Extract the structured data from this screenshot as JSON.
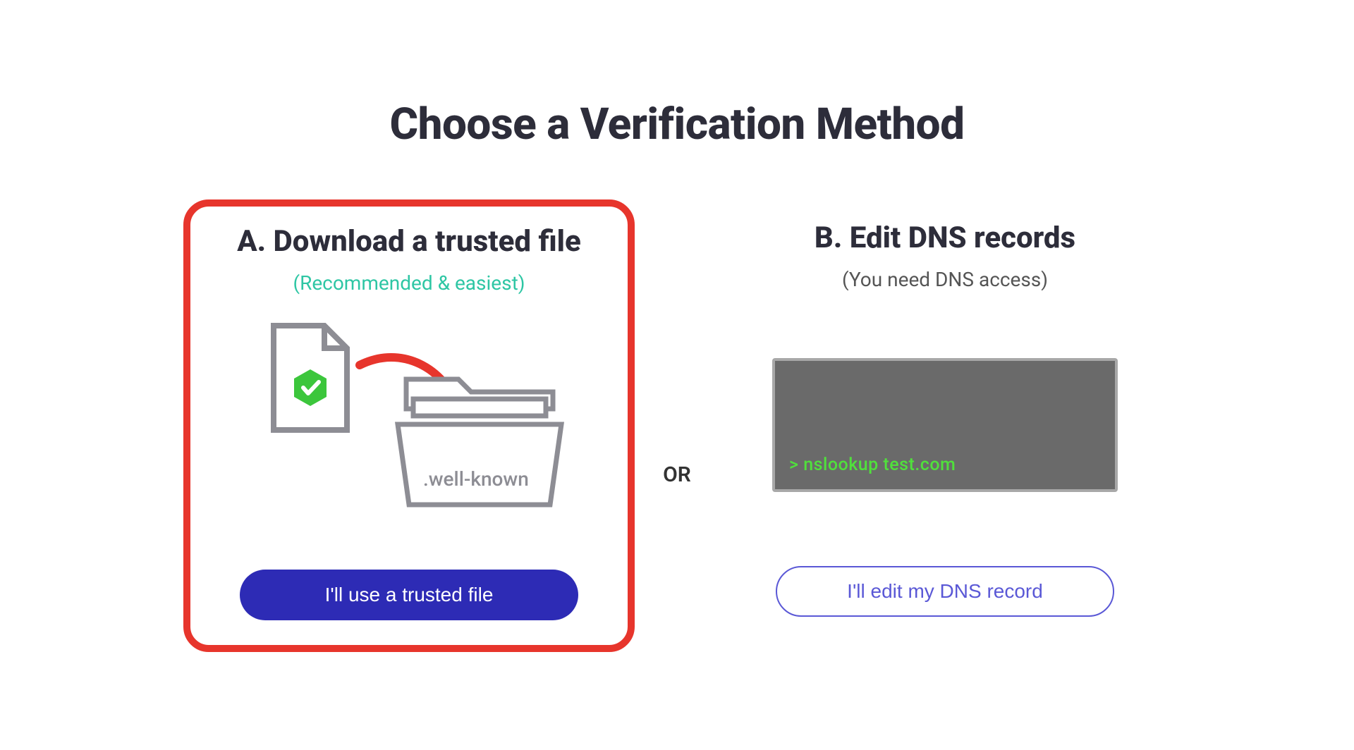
{
  "title": "Choose a Verification Method",
  "optionA": {
    "heading": "A.  Download a trusted file",
    "subtitle": "(Recommended & easiest)",
    "folder_label": ".well-known",
    "button": "I'll use a trusted file"
  },
  "optionB": {
    "heading": "B.  Edit DNS records",
    "subtitle": "(You need DNS access)",
    "terminal_line": "> nslookup test.com",
    "button": "I'll edit my DNS record"
  },
  "separator": "OR"
}
